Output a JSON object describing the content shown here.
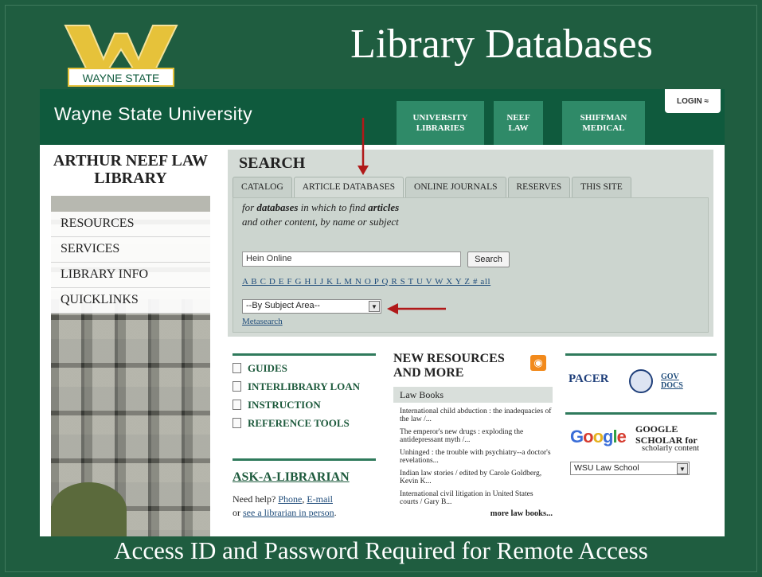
{
  "slide": {
    "title": "Library Databases",
    "footer": "Access ID and Password Required for Remote Access",
    "logo_text": "WAYNE STATE"
  },
  "site": {
    "university_name": "Wayne State University",
    "nav_tabs": [
      {
        "label": "UNIVERSITY\nLIBRARIES"
      },
      {
        "label": "NEEF\nLAW"
      },
      {
        "label": "SHIFFMAN\nMEDICAL"
      }
    ],
    "login_label": "LOGIN ≈"
  },
  "sidebar": {
    "library_name": "ARTHUR NEEF LAW LIBRARY",
    "items": [
      {
        "label": "RESOURCES"
      },
      {
        "label": "SERVICES"
      },
      {
        "label": "LIBRARY INFO"
      },
      {
        "label": "QUICKLINKS"
      }
    ]
  },
  "search": {
    "heading": "SEARCH",
    "tabs": [
      {
        "label": "CATALOG"
      },
      {
        "label": "ARTICLE DATABASES"
      },
      {
        "label": "ONLINE JOURNALS"
      },
      {
        "label": "RESERVES"
      },
      {
        "label": "THIS SITE"
      }
    ],
    "desc_line1_pre": "for ",
    "desc_line1_b1": "databases",
    "desc_line1_mid": " in which to find ",
    "desc_line1_b2": "articles",
    "desc_line2": "and other content, by name or subject",
    "input_value": "Hein Online",
    "button_label": "Search",
    "alphabet": "A B C D E F G H I J K L M N O P Q R S T U V W X Y Z # all",
    "subject_select": "--By Subject Area--",
    "metasearch": "Metasearch"
  },
  "guides": {
    "items": [
      {
        "label": "GUIDES"
      },
      {
        "label": "INTERLIBRARY LOAN"
      },
      {
        "label": "INSTRUCTION"
      },
      {
        "label": "REFERENCE TOOLS"
      }
    ]
  },
  "ask": {
    "title": "ASK-A-LIBRARIAN",
    "pre": "Need help? ",
    "phone": "Phone",
    "comma": ", ",
    "email": "E-mail",
    "mid": " or ",
    "in_person": "see a librarian in person",
    "end": "."
  },
  "new_resources": {
    "title": "NEW RESOURCES AND MORE",
    "section": "Law Books",
    "books": [
      "International child abduction : the inadequacies of the law /...",
      "The emperor's new drugs : exploding the antidepressant myth /...",
      "Unhinged : the trouble with psychiatry--a doctor's revelations...",
      "Indian law stories / edited by Carole Goldberg, Kevin K...",
      "International civil litigation in United States courts / Gary B..."
    ],
    "more": "more law books..."
  },
  "right": {
    "pacer": "PACER",
    "gov_docs": "GOV DOCS",
    "google": "Google",
    "google_scholar_tag": "Scholar",
    "scholar_title": "GOOGLE SCHOLAR for",
    "scholar_sub": "scholarly content",
    "wsu_select": "WSU Law School"
  },
  "colors": {
    "slide_bg": "#1f5d40",
    "topbar": "#0f5a3d",
    "accent": "#2f8a68",
    "arrow": "#b01919"
  }
}
